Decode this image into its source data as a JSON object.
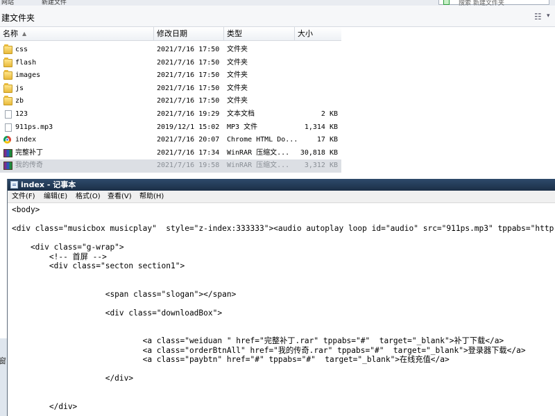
{
  "explorer": {
    "top_left_text": "网站",
    "top_mid_text": "新建文件",
    "search_placeholder": "搜索 新建文件夹",
    "folder_title": "建文件夹",
    "columns": {
      "name": "名称",
      "date": "修改日期",
      "type": "类型",
      "size": "大小"
    },
    "files": [
      {
        "name": "css",
        "date": "2021/7/16 17:50",
        "type": "文件夹",
        "size": "",
        "icon": "folder-icon"
      },
      {
        "name": "flash",
        "date": "2021/7/16 17:50",
        "type": "文件夹",
        "size": "",
        "icon": "folder-icon"
      },
      {
        "name": "images",
        "date": "2021/7/16 17:50",
        "type": "文件夹",
        "size": "",
        "icon": "folder-icon"
      },
      {
        "name": "js",
        "date": "2021/7/16 17:50",
        "type": "文件夹",
        "size": "",
        "icon": "folder-icon"
      },
      {
        "name": "zb",
        "date": "2021/7/16 17:50",
        "type": "文件夹",
        "size": "",
        "icon": "folder-icon"
      },
      {
        "name": "123",
        "date": "2021/7/16 19:29",
        "type": "文本文档",
        "size": "2 KB",
        "icon": "text-file-icon"
      },
      {
        "name": "911ps.mp3",
        "date": "2019/12/1 15:02",
        "type": "MP3 文件",
        "size": "1,314 KB",
        "icon": "blank-file-icon"
      },
      {
        "name": "index",
        "date": "2021/7/16 20:07",
        "type": "Chrome HTML Do...",
        "size": "17 KB",
        "icon": "chrome-icon"
      },
      {
        "name": "完整补丁",
        "date": "2021/7/16 17:34",
        "type": "WinRAR 压缩文...",
        "size": "30,818 KB",
        "icon": "winrar-icon"
      },
      {
        "name": "我的传奇",
        "date": "2021/7/16 19:58",
        "type": "WinRAR 压缩文...",
        "size": "3,312 KB",
        "icon": "winrar-icon",
        "selected": true
      }
    ],
    "left_edge_glyph": "窗"
  },
  "notepad": {
    "title": "index - 记事本",
    "menu": [
      "文件(F)",
      "编辑(E)",
      "格式(O)",
      "查看(V)",
      "帮助(H)"
    ],
    "lines": [
      "<body>",
      "",
      "<div class=\"musicbox musicplay\"  style=\"z-index:333333\"><audio autoplay loop id=\"audio\" src=\"911ps.mp3\" tppabs=\"http",
      "",
      "    <div class=\"g-wrap\">",
      "        <!-- 首屏 -->",
      "        <div class=\"secton section1\">",
      "",
      "",
      "                    <span class=\"slogan\"></span>",
      "",
      "                    <div class=\"downloadBox\">",
      "",
      "",
      "                            <a class=\"weiduan \" href=\"完整补丁.rar\" tppabs=\"#\"  target=\"_blank\">补丁下载</a>",
      "                            <a class=\"orderBtnAll\" href=\"我的传奇.rar\" tppabs=\"#\"  target=\"_blank\">登录器下载</a>",
      "                            <a class=\"paybtn\" href=\"#\" tppabs=\"#\"  target=\"_blank\">在线充值</a>",
      "",
      "                    </div>",
      "",
      "",
      "        </div>"
    ]
  }
}
